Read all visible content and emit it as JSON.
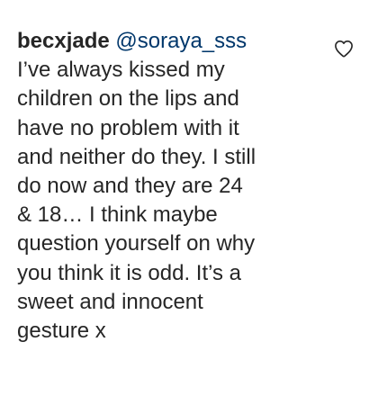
{
  "comment": {
    "username": "becxjade",
    "mention": "@soraya_sss",
    "lines": [
      "I’ve always kissed my",
      "children on the lips and",
      "have no problem with it",
      "and neither do they. I still",
      "do now and they are 24",
      "& 18… I think maybe",
      "question yourself on why",
      "you think it is odd. It’s a",
      "sweet and innocent",
      "gesture x"
    ]
  },
  "like_icon": "heart-outline-icon"
}
